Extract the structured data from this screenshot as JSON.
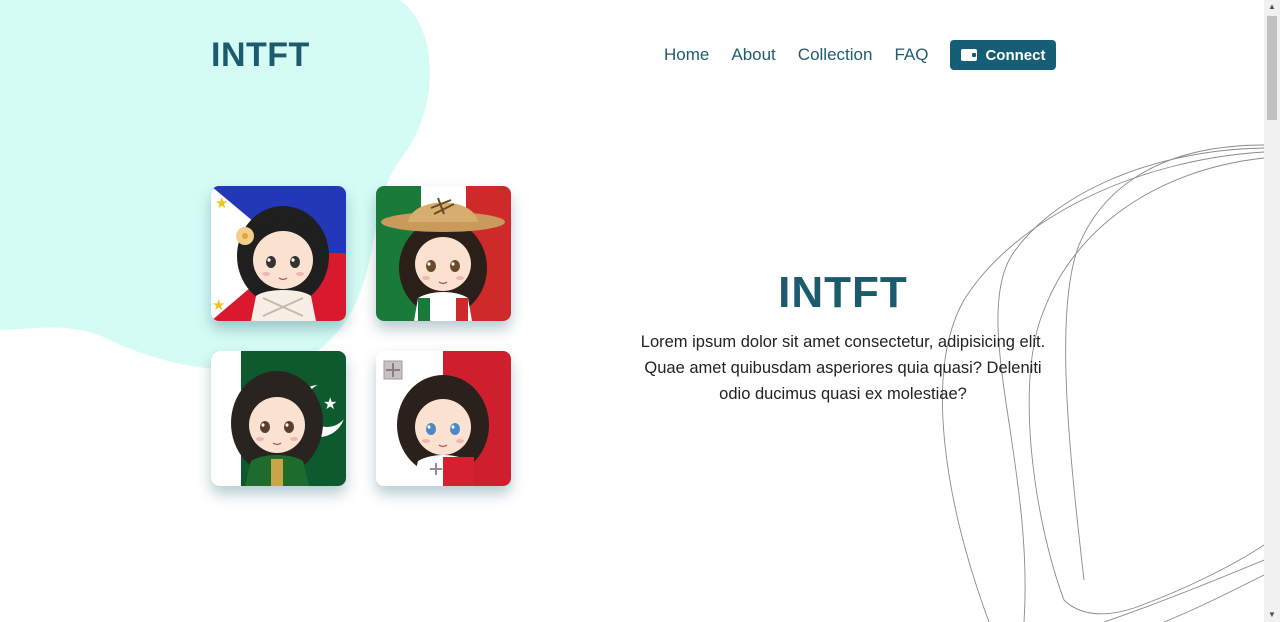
{
  "brand": {
    "logo": "INTFT"
  },
  "nav": {
    "items": [
      {
        "label": "Home"
      },
      {
        "label": "About"
      },
      {
        "label": "Collection"
      },
      {
        "label": "FAQ"
      }
    ],
    "connect_label": "Connect"
  },
  "hero": {
    "title": "INTFT",
    "text": "Lorem ipsum dolor sit amet consectetur, adipisicing elit. Quae amet quibusdam asperiores quia quasi? Deleniti odio ducimus quasi ex molestiae?"
  },
  "gallery": [
    {
      "name": "philippines-avatar",
      "flag": "Philippines"
    },
    {
      "name": "mexico-avatar",
      "flag": "Mexico"
    },
    {
      "name": "pakistan-avatar",
      "flag": "Pakistan"
    },
    {
      "name": "malta-avatar",
      "flag": "Malta"
    }
  ],
  "colors": {
    "brand": "#1c5a6e",
    "button": "#155e75",
    "blob": "#d5fbf5",
    "text": "#222222"
  },
  "icons": {
    "connect": "wallet-icon",
    "scroll_up": "arrow-up-icon",
    "scroll_down": "arrow-down-icon"
  }
}
